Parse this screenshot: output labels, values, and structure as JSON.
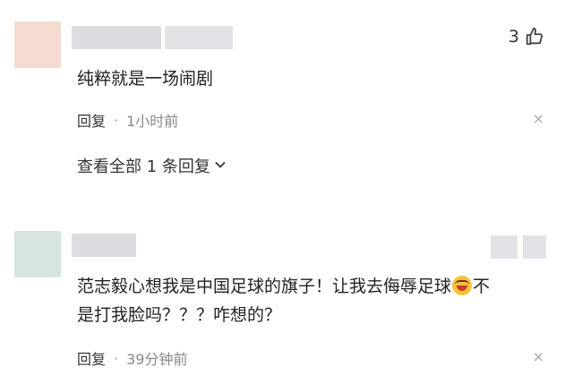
{
  "colors": {
    "avatar_1": "#f5dbd0",
    "avatar_2": "#d6e5e2",
    "icon_gray": "#444444"
  },
  "comment1": {
    "like_count": "3",
    "text": "纯粹就是一场闹剧",
    "reply_label": "回复",
    "separator": "·",
    "time": "1小时前",
    "close_icon": "×",
    "view_all": "查看全部 1 条回复",
    "chevron": "⌄"
  },
  "comment2": {
    "text_part1": "范志毅心想我是中国足球的旗子！让我去侮辱足球",
    "emoji_name": "laughing-crying-emoji",
    "text_part2": "不",
    "text_line2": "是打我脸吗？？？咋想的？",
    "reply_label": "回复",
    "separator": "·",
    "time": "39分钟前",
    "close_icon": "×"
  }
}
